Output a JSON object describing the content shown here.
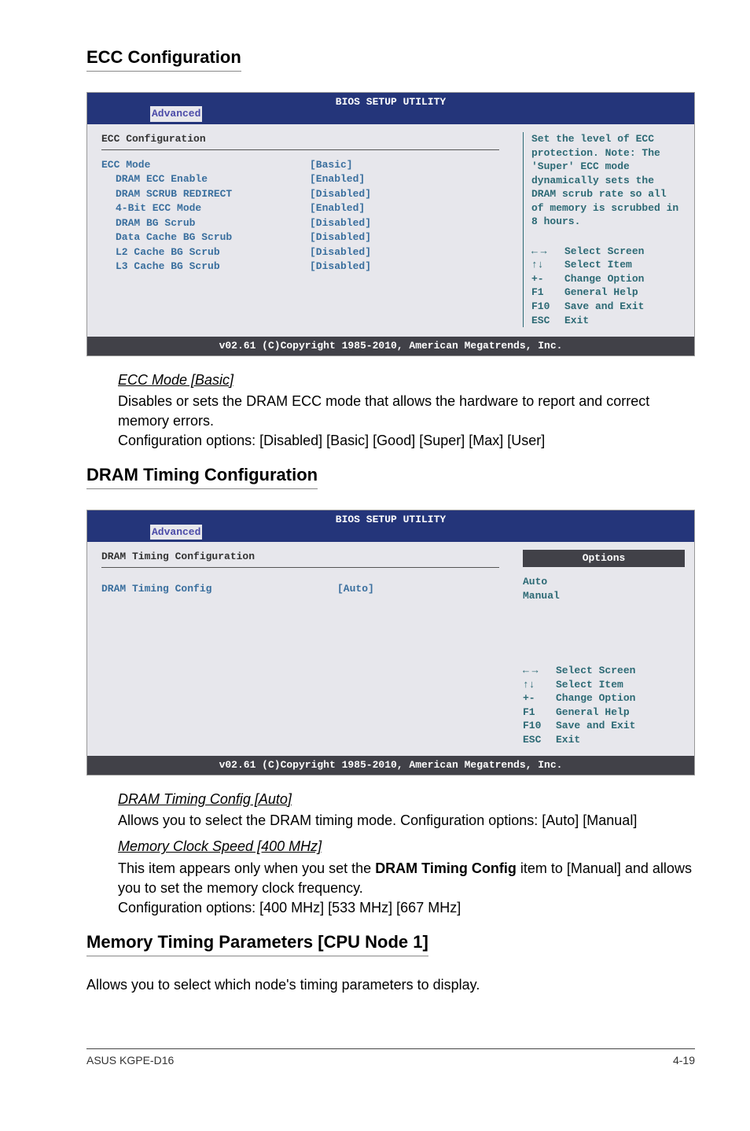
{
  "sections": {
    "ecc_title": "ECC Configuration",
    "dram_title": "DRAM Timing Configuration",
    "mem_timing_title": "Memory Timing Parameters [CPU Node 1]",
    "mem_timing_body": "Allows you to select which node's timing parameters to display."
  },
  "bios1": {
    "header_title": "BIOS SETUP UTILITY",
    "tab": "Advanced",
    "subheading": "ECC Configuration",
    "rows": [
      {
        "label": "ECC Mode",
        "value": "[Basic]",
        "first": true
      },
      {
        "label": "DRAM ECC Enable",
        "value": "[Enabled]"
      },
      {
        "label": "DRAM SCRUB REDIRECT",
        "value": "[Disabled]"
      },
      {
        "label": "4-Bit ECC Mode",
        "value": "[Enabled]"
      },
      {
        "label": "DRAM BG Scrub",
        "value": "[Disabled]"
      },
      {
        "label": "Data Cache BG Scrub",
        "value": "[Disabled]"
      },
      {
        "label": "L2 Cache BG Scrub",
        "value": "[Disabled]"
      },
      {
        "label": "L3 Cache BG Scrub",
        "value": "[Disabled]"
      }
    ],
    "help": "Set the level of ECC protection. Note: The 'Super' ECC mode dynamically sets the DRAM scrub rate so all of memory is scrubbed in 8 hours.",
    "nav": {
      "select_screen": "Select Screen",
      "select_item": "Select Item",
      "change_option": "Change Option",
      "general_help": "General Help",
      "save_exit": "Save and Exit",
      "exit": "Exit",
      "k_plusminus": "+-",
      "k_f1": "F1",
      "k_f10": "F10",
      "k_esc": "ESC"
    },
    "footer": "v02.61 (C)Copyright 1985-2010, American Megatrends, Inc."
  },
  "ecc_body": {
    "heading": "ECC Mode [Basic]",
    "line1": "Disables or sets the DRAM ECC mode that allows the hardware to report and correct memory errors.",
    "line2": "Configuration options: [Disabled] [Basic] [Good] [Super] [Max] [User]"
  },
  "bios2": {
    "header_title": "BIOS SETUP UTILITY",
    "tab": "Advanced",
    "subheading": "DRAM Timing Configuration",
    "rows": [
      {
        "label": "DRAM Timing Config",
        "value": "[Auto]",
        "first": true
      }
    ],
    "options_label": "Options",
    "options": {
      "o1": "Auto",
      "o2": "Manual"
    },
    "nav": {
      "select_screen": "Select Screen",
      "select_item": "Select Item",
      "change_option": "Change Option",
      "general_help": "General Help",
      "save_exit": "Save and Exit",
      "exit": "Exit",
      "k_plusminus": "+-",
      "k_f1": "F1",
      "k_f10": "F10",
      "k_esc": "ESC"
    },
    "footer": "v02.61 (C)Copyright 1985-2010, American Megatrends, Inc."
  },
  "dram_body": {
    "h1": "DRAM Timing Config [Auto]",
    "l1": "Allows you to select the DRAM timing mode. Configuration options: [Auto] [Manual]",
    "h2": "Memory Clock Speed [400 MHz]",
    "l2a": "This item appears only when you set the ",
    "l2b_bold": "DRAM Timing Config",
    "l2c": " item to [Manual] and allows you to set the memory clock frequency.",
    "l3": "Configuration options: [400 MHz] [533 MHz] [667 MHz]"
  },
  "page_footer": {
    "left": "ASUS KGPE-D16",
    "right": "4-19"
  }
}
